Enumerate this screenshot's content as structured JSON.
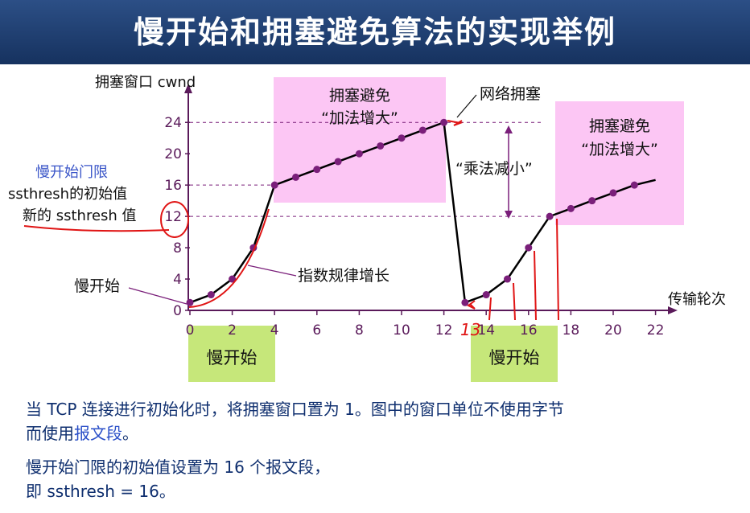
{
  "title": "慢开始和拥塞避免算法的实现举例",
  "chart_data": {
    "type": "line",
    "ylabel": "拥塞窗口 cwnd",
    "xlabel": "传输轮次",
    "x_ticks": [
      0,
      2,
      4,
      6,
      8,
      10,
      12,
      14,
      16,
      18,
      20,
      22
    ],
    "y_ticks": [
      0,
      4,
      8,
      12,
      16,
      20,
      24
    ],
    "xlim": [
      0,
      22
    ],
    "ylim": [
      0,
      24
    ],
    "gridlines_y": [
      12,
      16,
      24
    ],
    "series": [
      {
        "x": [
          0,
          1,
          2,
          3,
          4,
          5,
          6,
          7,
          8,
          9,
          10,
          11,
          12,
          13,
          14,
          15,
          16,
          17,
          18,
          19,
          20,
          21,
          22
        ],
        "y": [
          1,
          2,
          4,
          8,
          16,
          17,
          18,
          19,
          20,
          21,
          22,
          23,
          24,
          1,
          2,
          4,
          8,
          12,
          13,
          14,
          15,
          16,
          null
        ]
      }
    ],
    "point_x": [
      0,
      1,
      2,
      3,
      4,
      5,
      6,
      7,
      8,
      9,
      10,
      11,
      12,
      13,
      14,
      15,
      16,
      17,
      18,
      19,
      20,
      21
    ],
    "point_y": [
      1,
      2,
      4,
      8,
      16,
      17,
      18,
      19,
      20,
      21,
      22,
      23,
      24,
      1,
      2,
      4,
      8,
      12,
      13,
      14,
      15,
      16
    ],
    "end_point": [
      22,
      16.65
    ],
    "boxes": {
      "ca1_label_1": "拥塞避免",
      "ca1_label_2": "“加法增大”",
      "ca2_label_1": "拥塞避免",
      "ca2_label_2": "“加法增大”",
      "ss_label": "慢开始"
    },
    "annotations": {
      "congestion": "网络拥塞",
      "mult_decrease": "“乘法减小”",
      "exponential": "指数规律增长",
      "slow_start_left": "慢开始",
      "ssthresh_title": "慢开始门限",
      "ssthresh_initial": "ssthresh的初始值",
      "ssthresh_new": "新的 ssthresh 值"
    },
    "handwritten_13": "13"
  },
  "bottom": {
    "line1": "当 TCP 连接进行初始化时，将拥塞窗口置为 1。图中的窗口单位不使用字节",
    "line2a": "而使用",
    "line2b": "报文段",
    "line2c": "。",
    "line3": "慢开始门限的初始值设置为 16 个报文段，",
    "line4": "即 ssthresh = 16。"
  },
  "colors": {
    "axis": "#5a1a5a",
    "curve": "#000000",
    "point": "#7a1f7a",
    "pink": "#fcc6f4",
    "green": "#c6e77a",
    "red": "#e01414",
    "blue": "#3a55c8"
  }
}
